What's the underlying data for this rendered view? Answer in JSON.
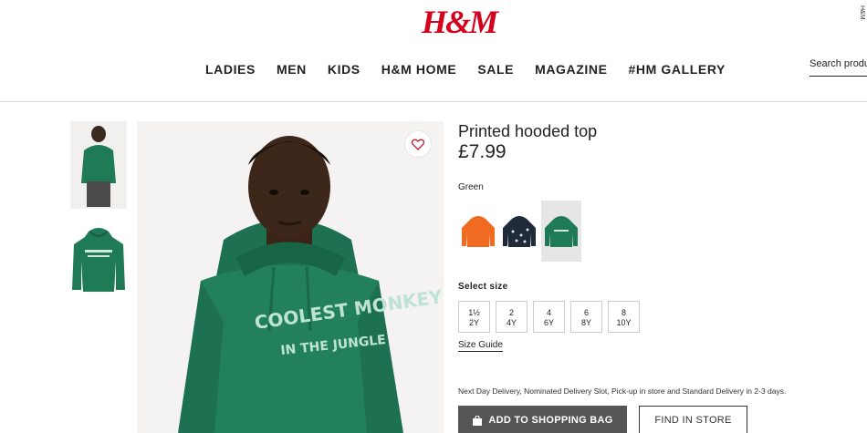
{
  "header": {
    "logo_text": "H&M",
    "corner_mark": "H&M",
    "nav": [
      "LADIES",
      "MEN",
      "KIDS",
      "H&M HOME",
      "SALE",
      "MAGAZINE",
      "#HM GALLERY"
    ],
    "search_placeholder": "Search products"
  },
  "product": {
    "title": "Printed hooded top",
    "price": "£7.99",
    "color_label": "Green",
    "hoodie_print_line1": "COOLEST MONKEY",
    "hoodie_print_line2": "IN THE JUNGLE",
    "swatches": [
      {
        "name": "orange",
        "color": "#f06a22"
      },
      {
        "name": "navy",
        "color": "#1f2a3a"
      },
      {
        "name": "green",
        "color": "#1f7a56",
        "selected": true
      }
    ],
    "size_label": "Select size",
    "sizes": [
      {
        "top": "1½",
        "bottom": "2Y"
      },
      {
        "top": "2",
        "bottom": "4Y"
      },
      {
        "top": "4",
        "bottom": "6Y"
      },
      {
        "top": "6",
        "bottom": "8Y"
      },
      {
        "top": "8",
        "bottom": "10Y"
      }
    ],
    "size_guide": "Size Guide",
    "delivery_text": "Next Day Delivery, Nominated Delivery Slot, Pick-up in store and Standard Delivery in 2-3 days.",
    "add_to_bag": "ADD TO SHOPPING BAG",
    "find_in_store": "FIND IN STORE"
  },
  "colors": {
    "brand_red": "#d6001c",
    "hoodie_green": "#1f7a56",
    "button_dark": "#555555"
  }
}
